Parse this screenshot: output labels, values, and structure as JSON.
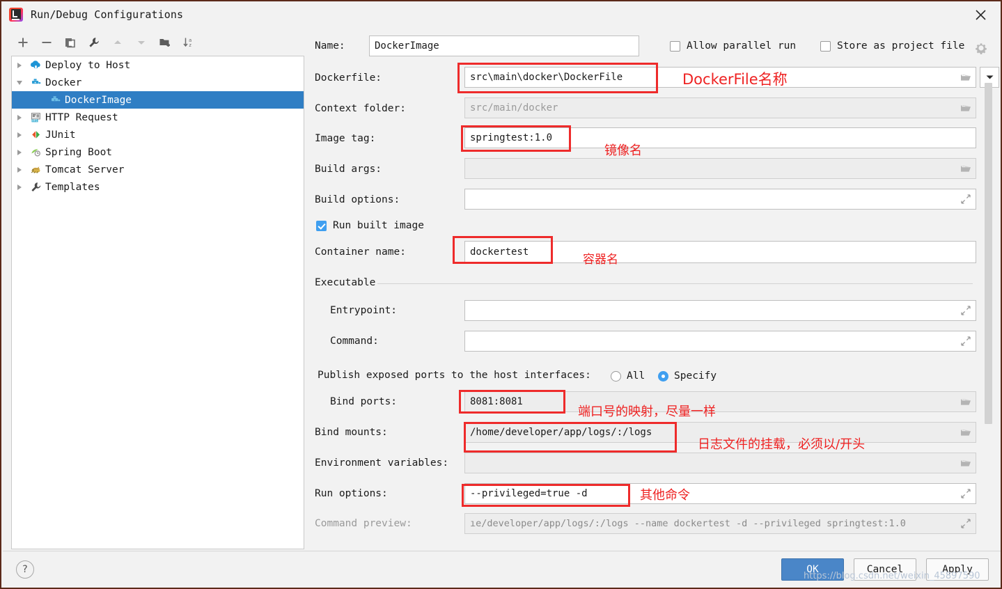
{
  "window": {
    "title": "Run/Debug Configurations",
    "app_icon": "intellij-idea-icon",
    "close_icon": "close-icon"
  },
  "toolbar": {
    "items": [
      {
        "name": "add-icon",
        "glyph": "+"
      },
      {
        "name": "remove-icon",
        "glyph": "−"
      },
      {
        "name": "copy-icon",
        "glyph": "copy"
      },
      {
        "name": "edit-templates-wrench-icon",
        "glyph": "wrench"
      },
      {
        "name": "move-up-icon",
        "glyph": "▲"
      },
      {
        "name": "move-down-icon",
        "glyph": "▼"
      },
      {
        "name": "new-folder-icon",
        "glyph": "folder-plus"
      },
      {
        "name": "sort-alphabetically-icon",
        "glyph": "sort-az"
      }
    ]
  },
  "tree": {
    "items": [
      {
        "label": "Deploy to Host",
        "icon": "deploy-to-host-icon",
        "expander": "collapsed",
        "level": 0,
        "selected": false
      },
      {
        "label": "Docker",
        "icon": "docker-icon",
        "expander": "expanded",
        "level": 0,
        "selected": false
      },
      {
        "label": "DockerImage",
        "icon": "docker-icon",
        "expander": "none",
        "level": 1,
        "selected": true
      },
      {
        "label": "HTTP Request",
        "icon": "http-request-icon",
        "expander": "collapsed",
        "level": 0,
        "selected": false
      },
      {
        "label": "JUnit",
        "icon": "junit-icon",
        "expander": "collapsed",
        "level": 0,
        "selected": false
      },
      {
        "label": "Spring Boot",
        "icon": "spring-boot-icon",
        "expander": "collapsed",
        "level": 0,
        "selected": false
      },
      {
        "label": "Tomcat Server",
        "icon": "tomcat-icon",
        "expander": "collapsed",
        "level": 0,
        "selected": false
      },
      {
        "label": "Templates",
        "icon": "templates-wrench-icon",
        "expander": "collapsed",
        "level": 0,
        "selected": false
      }
    ]
  },
  "form": {
    "name_label": "Name:",
    "name_value": "DockerImage",
    "allow_parallel_run_label": "Allow parallel run",
    "allow_parallel_run_checked": false,
    "store_as_project_file_label": "Store as project file",
    "store_as_project_file_checked": false,
    "gear_icon": "gear-icon",
    "dockerfile_label": "Dockerfile:",
    "dockerfile_value": "src\\main\\docker\\DockerFile",
    "context_folder_label": "Context folder:",
    "context_folder_placeholder": "src/main/docker",
    "image_tag_label": "Image tag:",
    "image_tag_value": "springtest:1.0",
    "build_args_label": "Build args:",
    "build_args_value": "",
    "build_options_label": "Build options:",
    "build_options_value": "",
    "run_built_image_label": "Run built image",
    "run_built_image_checked": true,
    "container_name_label": "Container name:",
    "container_name_value": "dockertest",
    "executable_section_label": "Executable",
    "entrypoint_label": "Entrypoint:",
    "entrypoint_value": "",
    "command_label": "Command:",
    "command_value": "",
    "publish_ports_label": "Publish exposed ports to the host interfaces:",
    "publish_all_label": "All",
    "publish_all_selected": false,
    "publish_specify_label": "Specify",
    "publish_specify_selected": true,
    "bind_ports_label": "Bind ports:",
    "bind_ports_value": "8081:8081",
    "bind_mounts_label": "Bind mounts:",
    "bind_mounts_value": "/home/developer/app/logs/:/logs",
    "environment_variables_label": "Environment variables:",
    "environment_variables_value": "",
    "run_options_label": "Run options:",
    "run_options_value": "--privileged=true -d",
    "command_preview_label": "Command preview:",
    "command_preview_value": "ıe/developer/app/logs/:/logs --name dockertest -d --privileged springtest:1.0"
  },
  "annotations": {
    "color": "#ee2222",
    "notes": [
      {
        "text": "DockerFile名称",
        "ref": "dockerfile"
      },
      {
        "text": "镜像名",
        "ref": "image-tag"
      },
      {
        "text": "容器名",
        "ref": "container-name"
      },
      {
        "text": "端口号的映射，尽量一样",
        "ref": "bind-ports"
      },
      {
        "text": "日志文件的挂载，必须以/开头",
        "ref": "bind-mounts"
      },
      {
        "text": "其他命令",
        "ref": "run-options"
      }
    ]
  },
  "footer": {
    "help_label": "?",
    "ok_label": "OK",
    "cancel_label": "Cancel",
    "apply_label": "Apply",
    "watermark": "https://blog.csdn.net/weixin_45897590"
  }
}
